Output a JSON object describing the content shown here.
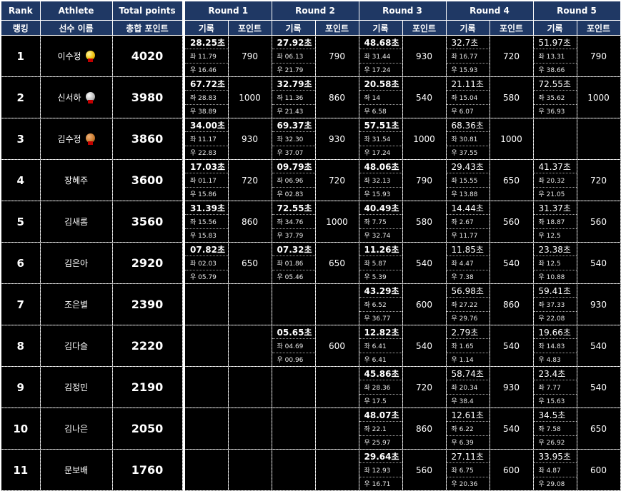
{
  "headers": {
    "rank": "Rank",
    "athlete": "Athlete",
    "total": "Total points",
    "rounds": [
      "Round 1",
      "Round 2",
      "Round 3",
      "Round 4",
      "Round 5"
    ],
    "rank_ko": "랭킹",
    "athlete_ko": "선수 이름",
    "total_ko": "총합 포인트",
    "record_ko": "기록",
    "points_ko": "포인트"
  },
  "medal_colors": {
    "gold": "#f1c40f",
    "silver": "#c0c0c0",
    "bronze": "#cd7f32"
  },
  "rows": [
    {
      "rank": "1",
      "name": "이수정",
      "medal": "gold",
      "total": "4020",
      "rounds": [
        {
          "time": "28.25초",
          "left": "좌 11.79",
          "right": "우 16.46",
          "points": "790",
          "bold": true
        },
        {
          "time": "27.92초",
          "left": "좌 06.13",
          "right": "우 21.79",
          "points": "790",
          "bold": true
        },
        {
          "time": "48.68초",
          "left": "좌 31.44",
          "right": "우 17.24",
          "points": "930",
          "bold": true
        },
        {
          "time": "32.7초",
          "left": "좌 16.77",
          "right": "우 15.93",
          "points": "720",
          "bold": false
        },
        {
          "time": "51.97초",
          "left": "좌 13.31",
          "right": "우 38.66",
          "points": "790",
          "bold": false
        }
      ]
    },
    {
      "rank": "2",
      "name": "신서하",
      "medal": "silver",
      "total": "3980",
      "rounds": [
        {
          "time": "67.72초",
          "left": "좌 28.83",
          "right": "우 38.89",
          "points": "1000",
          "bold": true
        },
        {
          "time": "32.79초",
          "left": "좌 11.36",
          "right": "우 21.43",
          "points": "860",
          "bold": true
        },
        {
          "time": "20.58초",
          "left": "좌 14",
          "right": "우 6.58",
          "points": "540",
          "bold": true
        },
        {
          "time": "21.11초",
          "left": "좌 15.04",
          "right": "우 6.07",
          "points": "580",
          "bold": false
        },
        {
          "time": "72.55초",
          "left": "좌 35.62",
          "right": "우 36.93",
          "points": "1000",
          "bold": false
        }
      ]
    },
    {
      "rank": "3",
      "name": "김수정",
      "medal": "bronze",
      "total": "3860",
      "rounds": [
        {
          "time": "34.00초",
          "left": "좌 11.17",
          "right": "우 22.83",
          "points": "930",
          "bold": true
        },
        {
          "time": "69.37초",
          "left": "좌 32.30",
          "right": "우 37.07",
          "points": "930",
          "bold": true
        },
        {
          "time": "57.51초",
          "left": "좌 31.54",
          "right": "우 17.24",
          "points": "1000",
          "bold": true
        },
        {
          "time": "68.36초",
          "left": "좌 30.81",
          "right": "우 37.55",
          "points": "1000",
          "bold": false
        },
        null
      ]
    },
    {
      "rank": "4",
      "name": "장혜주",
      "total": "3600",
      "rounds": [
        {
          "time": "17.03초",
          "left": "좌 01.17",
          "right": "우 15.86",
          "points": "720",
          "bold": true
        },
        {
          "time": "09.79초",
          "left": "좌 06.96",
          "right": "우 02.83",
          "points": "720",
          "bold": true
        },
        {
          "time": "48.06초",
          "left": "좌 32.13",
          "right": "우 15.93",
          "points": "790",
          "bold": true
        },
        {
          "time": "29.43초",
          "left": "좌 15.55",
          "right": "우 13.88",
          "points": "650",
          "bold": false
        },
        {
          "time": "41.37초",
          "left": "좌 20.32",
          "right": "우 21.05",
          "points": "720",
          "bold": false
        }
      ]
    },
    {
      "rank": "5",
      "name": "김새롬",
      "total": "3560",
      "rounds": [
        {
          "time": "31.39초",
          "left": "좌 15.56",
          "right": "우 15.83",
          "points": "860",
          "bold": true
        },
        {
          "time": "72.55초",
          "left": "좌 34.76",
          "right": "우 37.79",
          "points": "1000",
          "bold": true
        },
        {
          "time": "40.49초",
          "left": "좌 7.75",
          "right": "우 32.74",
          "points": "580",
          "bold": true
        },
        {
          "time": "14.44초",
          "left": "좌 2.67",
          "right": "우 11.77",
          "points": "560",
          "bold": false
        },
        {
          "time": "31.37초",
          "left": "좌 18.87",
          "right": "우 12.5",
          "points": "560",
          "bold": false
        }
      ]
    },
    {
      "rank": "6",
      "name": "김은아",
      "total": "2920",
      "rounds": [
        {
          "time": "07.82초",
          "left": "좌 02.03",
          "right": "우 05.79",
          "points": "650",
          "bold": true
        },
        {
          "time": "07.32초",
          "left": "좌 01.86",
          "right": "우 05.46",
          "points": "650",
          "bold": true
        },
        {
          "time": "11.26초",
          "left": "좌 5.87",
          "right": "우 5.39",
          "points": "540",
          "bold": true
        },
        {
          "time": "11.85초",
          "left": "좌 4.47",
          "right": "우 7.38",
          "points": "540",
          "bold": false
        },
        {
          "time": "23.38초",
          "left": "좌 12.5",
          "right": "우 10.88",
          "points": "540",
          "bold": false
        }
      ]
    },
    {
      "rank": "7",
      "name": "조은별",
      "total": "2390",
      "rounds": [
        null,
        null,
        {
          "time": "43.29초",
          "left": "좌 6.52",
          "right": "우 36.77",
          "points": "600",
          "bold": true
        },
        {
          "time": "56.98초",
          "left": "좌 27.22",
          "right": "우 29.76",
          "points": "860",
          "bold": false
        },
        {
          "time": "59.41초",
          "left": "좌 37.33",
          "right": "우 22.08",
          "points": "930",
          "bold": false
        }
      ]
    },
    {
      "rank": "8",
      "name": "김다슬",
      "total": "2220",
      "rounds": [
        null,
        {
          "time": "05.65초",
          "left": "좌 04.69",
          "right": "우 00.96",
          "points": "600",
          "bold": true
        },
        {
          "time": "12.82초",
          "left": "좌 6.41",
          "right": "우 6.41",
          "points": "540",
          "bold": true
        },
        {
          "time": "2.79초",
          "left": "좌 1.65",
          "right": "우 1.14",
          "points": "540",
          "bold": false
        },
        {
          "time": "19.66초",
          "left": "좌 14.83",
          "right": "우 4.83",
          "points": "540",
          "bold": false
        }
      ]
    },
    {
      "rank": "9",
      "name": "김정민",
      "total": "2190",
      "rounds": [
        null,
        null,
        {
          "time": "45.86초",
          "left": "좌 28.36",
          "right": "우 17.5",
          "points": "720",
          "bold": true
        },
        {
          "time": "58.74초",
          "left": "좌 20.34",
          "right": "우 38.4",
          "points": "930",
          "bold": false
        },
        {
          "time": "23.4초",
          "left": "좌 7.77",
          "right": "우 15.63",
          "points": "540",
          "bold": false
        }
      ]
    },
    {
      "rank": "10",
      "name": "김나은",
      "total": "2050",
      "rounds": [
        null,
        null,
        {
          "time": "48.07초",
          "left": "좌 22.1",
          "right": "우 25.97",
          "points": "860",
          "bold": true
        },
        {
          "time": "12.61초",
          "left": "좌 6.22",
          "right": "우 6.39",
          "points": "540",
          "bold": false
        },
        {
          "time": "34.5초",
          "left": "좌 7.58",
          "right": "우 26.92",
          "points": "650",
          "bold": false
        }
      ]
    },
    {
      "rank": "11",
      "name": "문보배",
      "total": "1760",
      "rounds": [
        null,
        null,
        {
          "time": "29.64초",
          "left": "좌 12.93",
          "right": "우 16.71",
          "points": "560",
          "bold": true
        },
        {
          "time": "27.11초",
          "left": "좌 6.75",
          "right": "우 20.36",
          "points": "600",
          "bold": false
        },
        {
          "time": "33.95초",
          "left": "좌 4.87",
          "right": "우 29.08",
          "points": "600",
          "bold": false
        }
      ]
    }
  ]
}
